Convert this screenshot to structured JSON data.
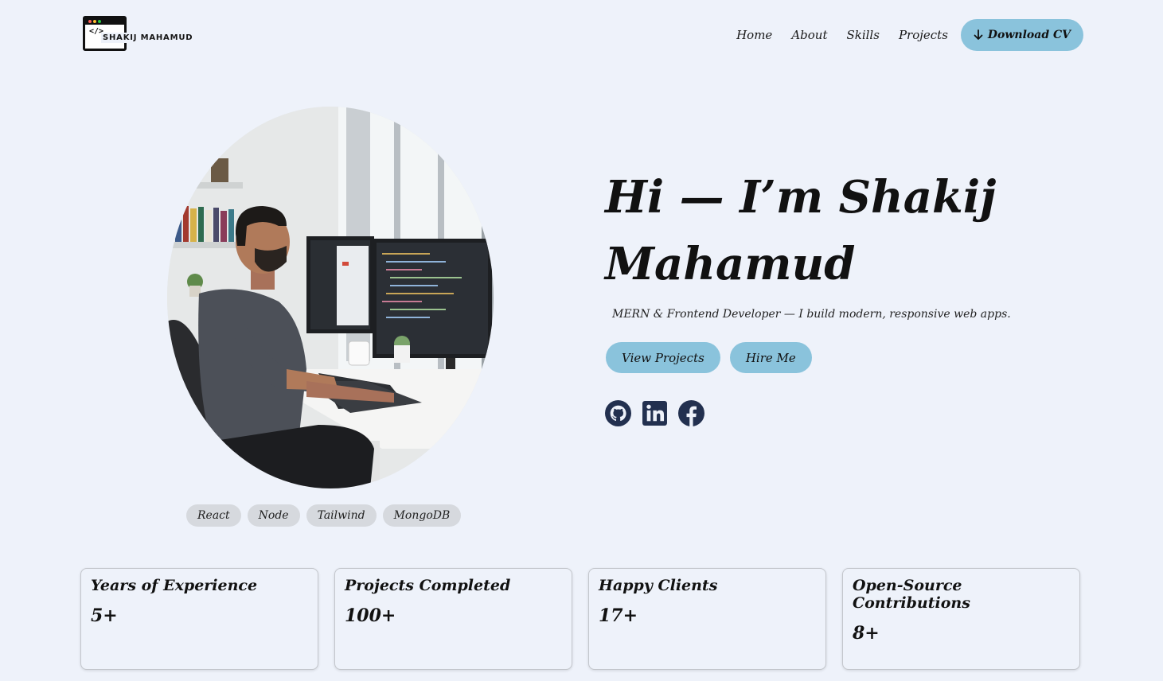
{
  "brand": {
    "logo_code": "</>",
    "name": "SHAKIJ MAHAMUD"
  },
  "nav": {
    "items": [
      {
        "label": "Home"
      },
      {
        "label": "About"
      },
      {
        "label": "Skills"
      },
      {
        "label": "Projects"
      }
    ],
    "cv_button": "Download CV"
  },
  "hero": {
    "title": "Hi — I’m Shakij Mahamud",
    "subtitle": "MERN & Frontend Developer — I build modern, responsive web apps.",
    "primary_button": "View Projects",
    "secondary_button": "Hire Me",
    "socials": [
      "github-icon",
      "linkedin-icon",
      "facebook-icon"
    ],
    "tags": [
      "React",
      "Node",
      "Tailwind",
      "MongoDB"
    ]
  },
  "stats": [
    {
      "label": "Years of Experience",
      "value": "5+"
    },
    {
      "label": "Projects Completed",
      "value": "100+"
    },
    {
      "label": "Happy Clients",
      "value": "17+"
    },
    {
      "label": "Open-Source Contributions",
      "value": "8+"
    }
  ],
  "colors": {
    "background": "#eef2fa",
    "accent": "#8ac3dc",
    "tag": "#d6d9de",
    "icon": "#22304f"
  }
}
